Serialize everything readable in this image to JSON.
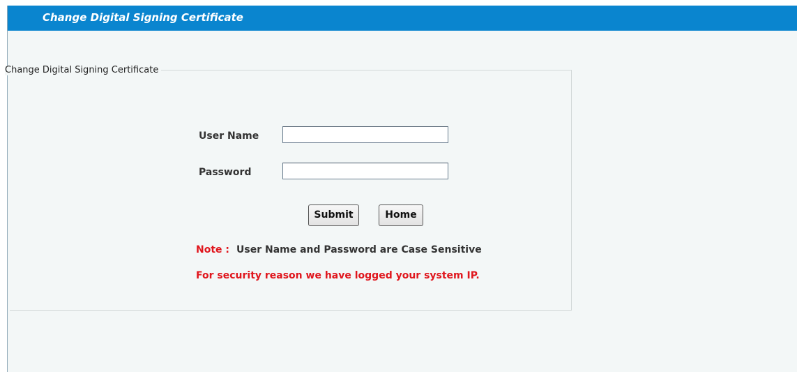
{
  "header": {
    "title": "Change Digital Signing Certificate"
  },
  "form": {
    "legend": "Change Digital Signing Certificate",
    "username_label": "User Name",
    "username_value": "",
    "password_label": "Password",
    "password_value": "",
    "submit_label": "Submit",
    "home_label": "Home"
  },
  "notes": {
    "note_label": "Note :",
    "note_text": "User Name and Password are Case Sensitive",
    "security_text": "For security reason we have logged your system IP."
  },
  "colors": {
    "header_bg": "#0a85cf",
    "content_bg": "#f3f7f7",
    "warning_red": "#e0161d"
  }
}
